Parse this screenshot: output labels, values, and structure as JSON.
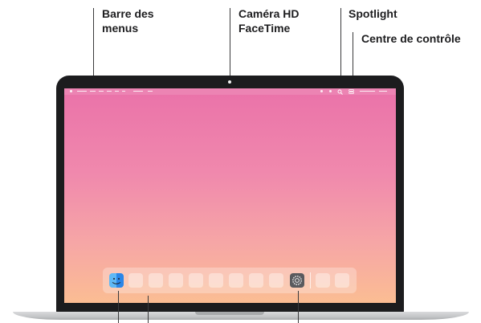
{
  "callouts": {
    "menu_bar_line1": "Barre des",
    "menu_bar_line2": "menus",
    "camera_line1": "Caméra HD",
    "camera_line2": "FaceTime",
    "spotlight": "Spotlight",
    "control_center": "Centre de contrôle"
  },
  "icons": {
    "finder": "finder-icon",
    "system_preferences": "gear-icon",
    "spotlight": "search-icon",
    "control_center": "control-center-icon"
  },
  "colors": {
    "wallpaper_top": "#ea72a9",
    "wallpaper_bottom": "#fbbd93",
    "bezel": "#1c1c1e"
  }
}
